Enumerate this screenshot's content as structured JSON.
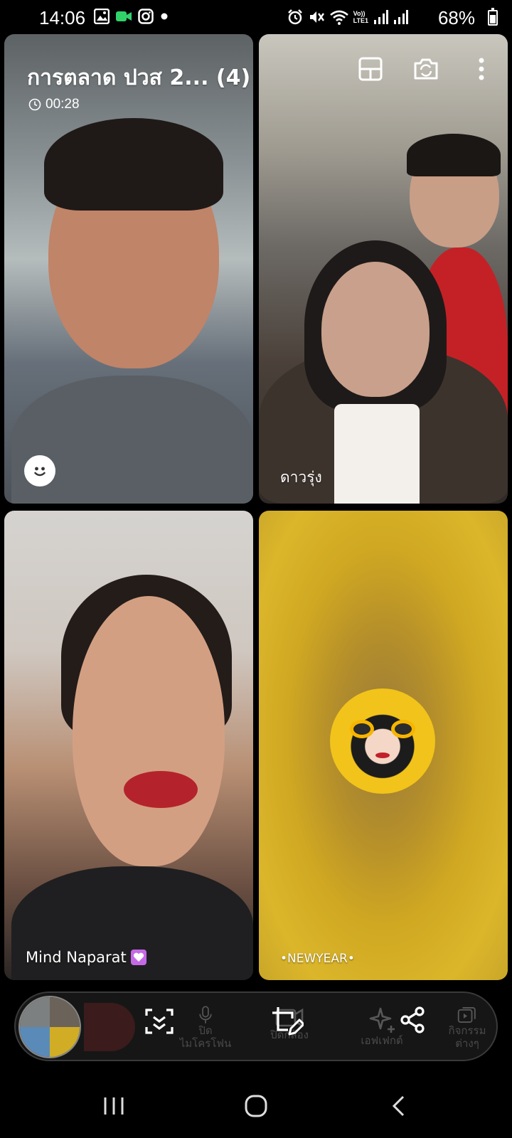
{
  "status_bar": {
    "time": "14:06",
    "battery": "68%",
    "battery_level": 0.68,
    "left_icons": [
      "gallery-icon",
      "video-icon",
      "instagram-icon",
      "dot-icon"
    ],
    "right_icons": [
      "alarm-icon",
      "mute-icon",
      "wifi-icon",
      "volte-icon",
      "signal-icon",
      "signal-icon"
    ],
    "volte_label_top": "Vo))",
    "volte_label_bottom": "LTE1"
  },
  "call": {
    "group_title": "การตลาด ปวส 2... (4)",
    "duration": "00:28"
  },
  "participants": [
    {
      "name": ""
    },
    {
      "name": "ดาวรุ่ง"
    },
    {
      "name": "Mind Naparat",
      "badge": "heart-icon"
    },
    {
      "name": "•NEWYEAR•"
    }
  ],
  "controls": {
    "items": [
      {
        "icon": "hangup-icon",
        "label": ""
      },
      {
        "icon": "capture-icon",
        "label": ""
      },
      {
        "icon": "microphone-icon",
        "label": "ปิด\nไมโครโฟน"
      },
      {
        "icon": "camera-off-icon",
        "label": "ปิดกล้อง"
      },
      {
        "icon": "edit-frame-icon",
        "label": ""
      },
      {
        "icon": "sparkle-icon",
        "label": "เอฟเฟกต์"
      },
      {
        "icon": "share-icon",
        "label": ""
      },
      {
        "icon": "activities-icon",
        "label": "กิจกรรม\nต่างๆ"
      }
    ]
  },
  "nav_bar": {
    "items": [
      "recents-icon",
      "home-icon",
      "back-icon"
    ]
  }
}
